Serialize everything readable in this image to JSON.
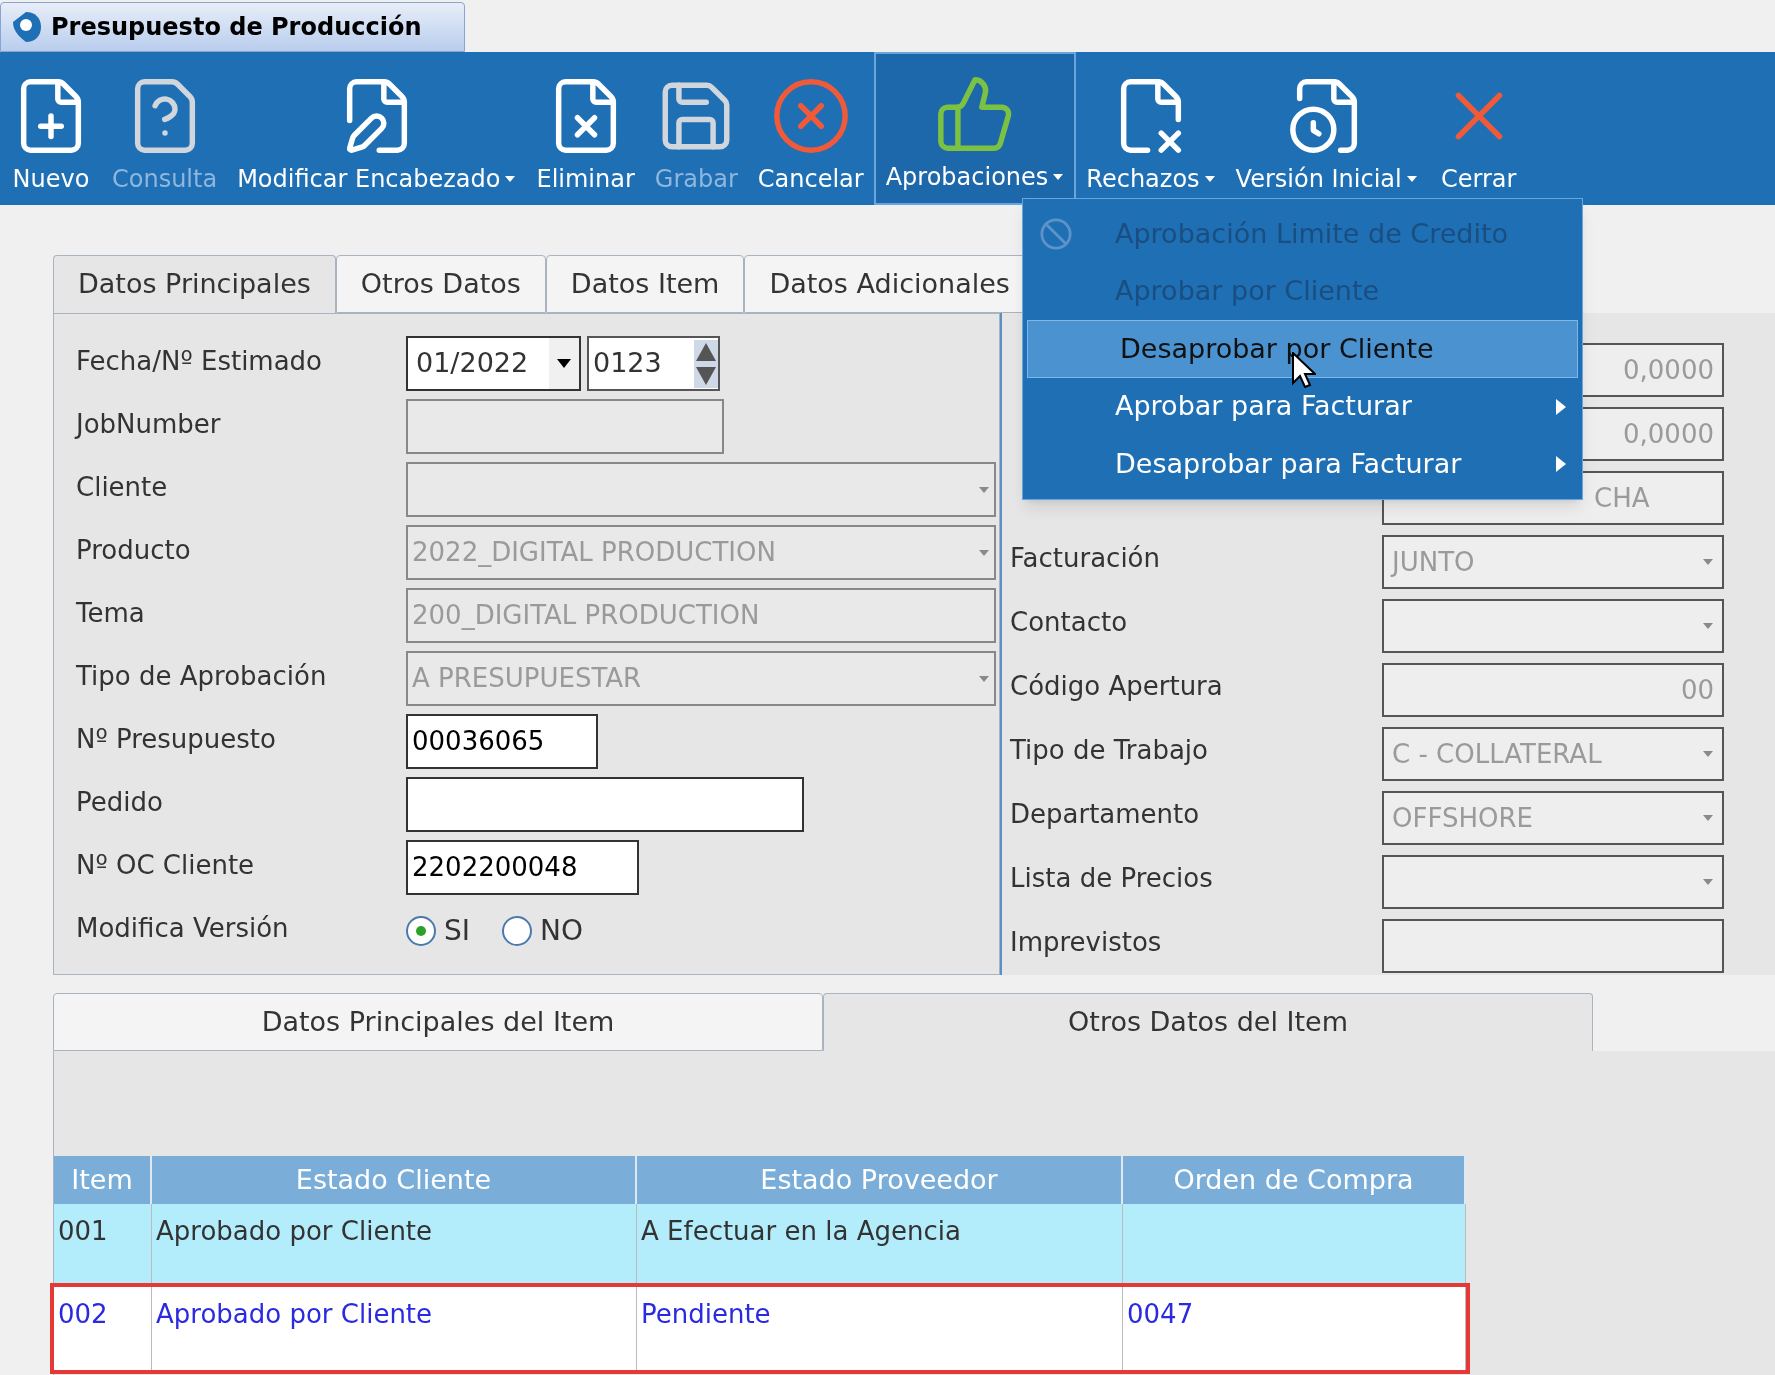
{
  "window": {
    "title": "Presupuesto de Producción"
  },
  "toolbar": [
    {
      "label": "Nuevo",
      "kind": "new",
      "disabled": false,
      "dropdown": false,
      "active": false
    },
    {
      "label": "Consulta",
      "kind": "query",
      "disabled": true,
      "dropdown": false,
      "active": false
    },
    {
      "label": "Modificar Encabezado",
      "kind": "edit",
      "disabled": false,
      "dropdown": true,
      "active": false
    },
    {
      "label": "Eliminar",
      "kind": "delete",
      "disabled": false,
      "dropdown": false,
      "active": false
    },
    {
      "label": "Grabar",
      "kind": "save",
      "disabled": true,
      "dropdown": false,
      "active": false
    },
    {
      "label": "Cancelar",
      "kind": "cancel",
      "disabled": false,
      "dropdown": false,
      "active": false
    },
    {
      "label": "Aprobaciones",
      "kind": "approve",
      "disabled": false,
      "dropdown": true,
      "active": true
    },
    {
      "label": "Rechazos",
      "kind": "reject",
      "disabled": false,
      "dropdown": true,
      "active": false
    },
    {
      "label": "Versión Inicial",
      "kind": "version",
      "disabled": false,
      "dropdown": true,
      "active": false
    },
    {
      "label": "Cerrar",
      "kind": "close",
      "disabled": false,
      "dropdown": false,
      "active": false
    }
  ],
  "menu": [
    {
      "label": "Aprobación Limite de Credito",
      "kind": "blocked",
      "disabled": true,
      "selected": false
    },
    {
      "label": "Aprobar por Cliente",
      "kind": "plain",
      "disabled": true,
      "selected": false
    },
    {
      "label": "Desaprobar por Cliente",
      "kind": "plain",
      "disabled": false,
      "selected": true
    },
    {
      "label": "Aprobar para Facturar",
      "kind": "submenu",
      "disabled": false,
      "selected": false
    },
    {
      "label": "Desaprobar para Facturar",
      "kind": "submenu",
      "disabled": false,
      "selected": false
    }
  ],
  "tabs": [
    {
      "label": "Datos Principales",
      "selected": true
    },
    {
      "label": "Otros Datos",
      "selected": false
    },
    {
      "label": "Datos Item",
      "selected": false
    },
    {
      "label": "Datos Adicionales",
      "selected": false
    }
  ],
  "left_fields": [
    {
      "label": "Fecha/Nº Estimado",
      "kind": "date",
      "value": "01/2022",
      "number": "0123",
      "disabled": false
    },
    {
      "label": "JobNumber",
      "kind": "text",
      "disabled": true
    },
    {
      "label": "Cliente",
      "kind": "select",
      "disabled": true
    },
    {
      "label": "Producto",
      "kind": "select",
      "value": "2022_DIGITAL PRODUCTION",
      "disabled": true
    },
    {
      "label": "Tema",
      "kind": "text",
      "value": "200_DIGITAL PRODUCTION",
      "disabled": true
    },
    {
      "label": "Tipo de Aprobación",
      "kind": "select",
      "value": "A PRESUPUESTAR",
      "disabled": true
    },
    {
      "label": "Nº Presupuesto",
      "kind": "text",
      "value": "00036065",
      "disabled": false
    },
    {
      "label": "Pedido",
      "kind": "text",
      "disabled": false
    },
    {
      "label": "Nº OC Cliente",
      "kind": "text",
      "value": "2202200048",
      "disabled": false
    },
    {
      "label": "Modifica Versión",
      "kind": "radio",
      "options": [
        {
          "label": "SI",
          "selected": true
        },
        {
          "label": "NO",
          "selected": false
        }
      ]
    }
  ],
  "right_hidden_fields": [
    {
      "value": "0,0000"
    },
    {
      "value": "0,0000"
    },
    {
      "value": "CHA"
    }
  ],
  "right_fields": [
    {
      "label": "Facturación",
      "kind": "select",
      "value": "JUNTO"
    },
    {
      "label": "Contacto",
      "kind": "select"
    },
    {
      "label": "Código Apertura",
      "kind": "number",
      "value": "00"
    },
    {
      "label": "Tipo de Trabajo",
      "kind": "select",
      "value": "C - COLLATERAL"
    },
    {
      "label": "Departamento",
      "kind": "select",
      "value": "OFFSHORE"
    },
    {
      "label": "Lista de Precios",
      "kind": "select"
    },
    {
      "label": "Imprevistos",
      "kind": "text"
    }
  ],
  "item_tabs": [
    {
      "label": "Datos Principales del Item",
      "selected": false
    },
    {
      "label": "Otros Datos del Item",
      "selected": true
    }
  ],
  "table": {
    "columns": [
      "Item",
      "Estado Cliente",
      "Estado Proveedor",
      "Orden de Compra"
    ],
    "rows": [
      {
        "cells": [
          "001",
          "Aprobado por Cliente",
          "A Efectuar en la Agencia",
          ""
        ],
        "selected": true,
        "highlighted": false
      },
      {
        "cells": [
          "002",
          "Aprobado por Cliente",
          "Pendiente",
          "0047"
        ],
        "selected": false,
        "highlighted": true
      }
    ]
  }
}
